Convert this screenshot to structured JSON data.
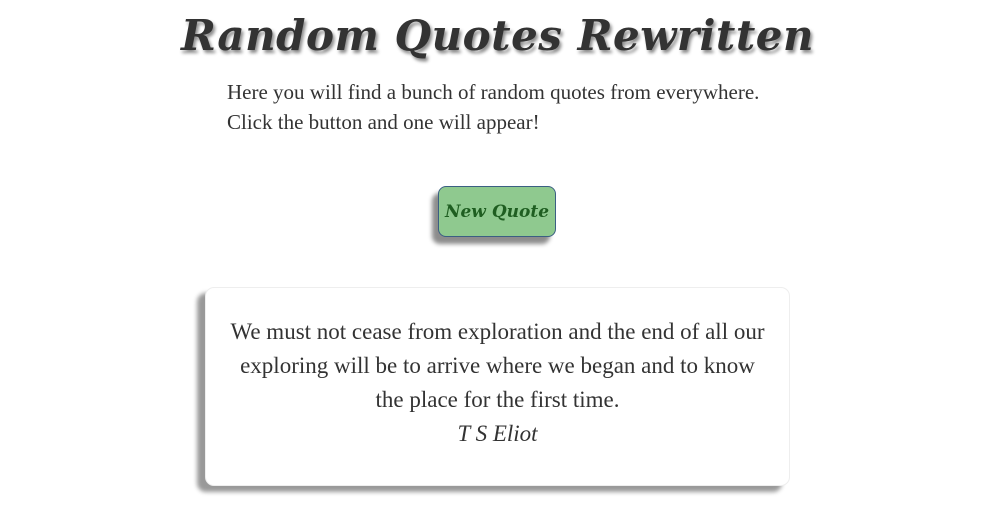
{
  "header": {
    "title": "Random Quotes Rewritten"
  },
  "intro": {
    "line1": "Here you will find a bunch of random quotes from everywhere.",
    "line2": "Click the button and one will appear!"
  },
  "button": {
    "label": "New Quote"
  },
  "quote": {
    "text": "We must not cease from exploration and the end of all our exploring will be to arrive where we began and to know the place for the first time.",
    "author": "T S Eliot"
  },
  "colors": {
    "button_background": "#8fc98f",
    "button_border": "#3b5f83",
    "button_text": "#1f5e21",
    "text": "#333333",
    "page_background": "#ffffff"
  }
}
